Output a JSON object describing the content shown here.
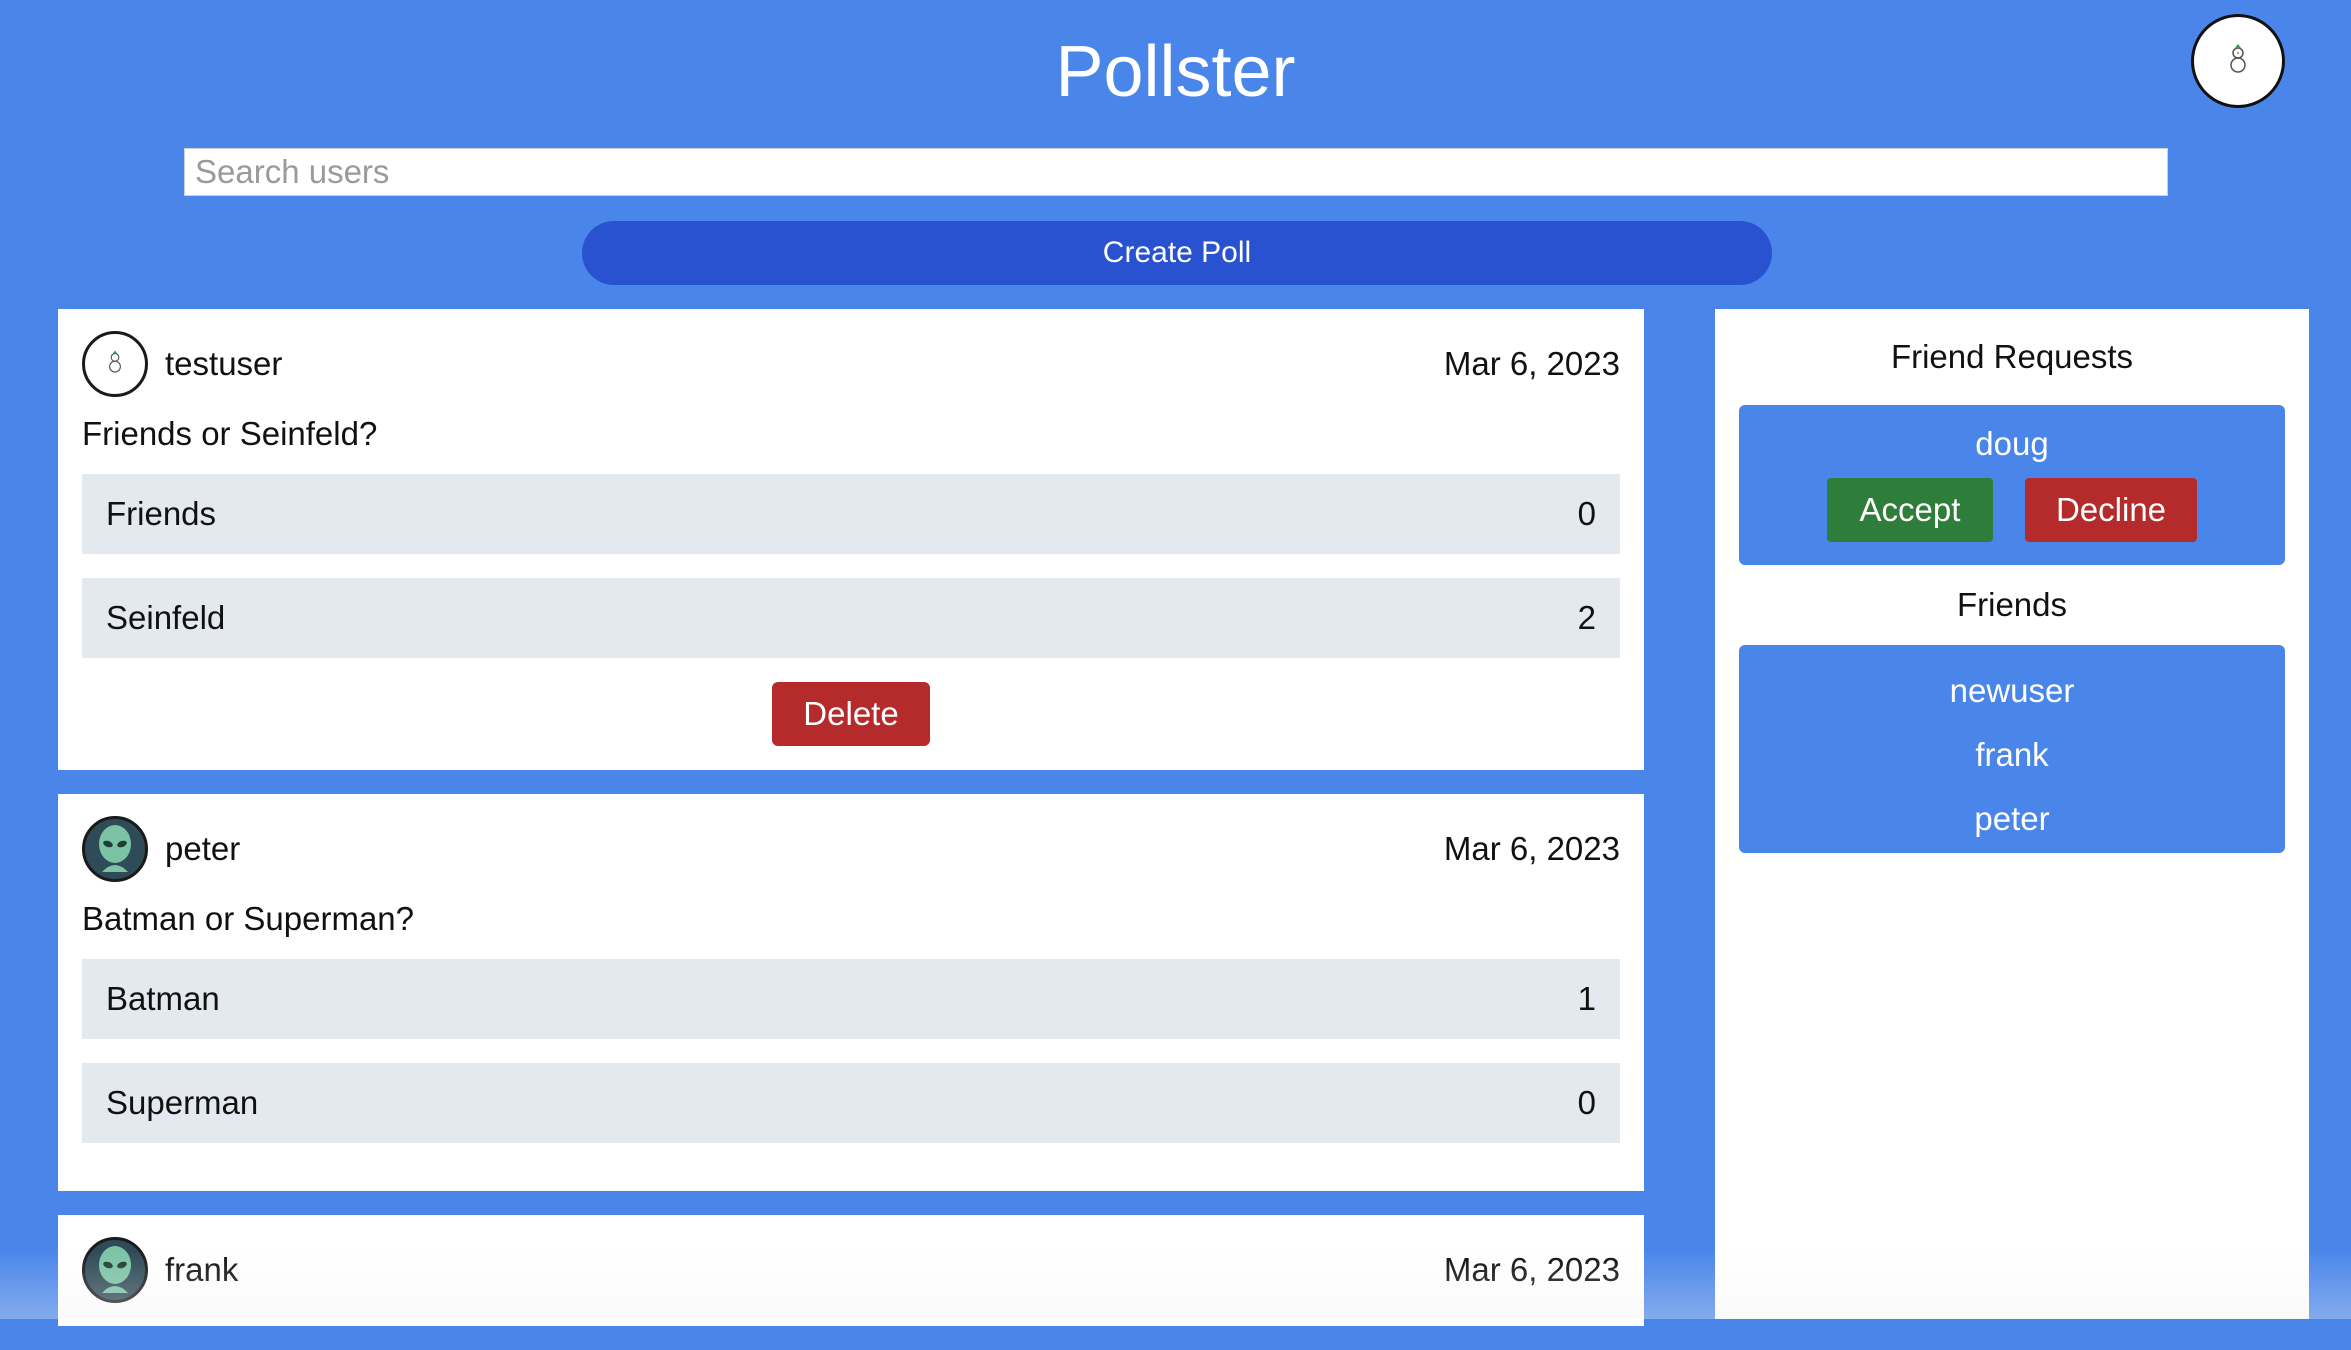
{
  "header": {
    "title": "Pollster",
    "profile_icon": "snowman-icon"
  },
  "search": {
    "placeholder": "Search users",
    "value": ""
  },
  "create_poll": {
    "label": "Create Poll"
  },
  "polls": [
    {
      "username": "testuser",
      "avatar_icon": "snowman-icon",
      "date": "Mar 6, 2023",
      "question": "Friends or Seinfeld?",
      "options": [
        {
          "label": "Friends",
          "votes": "0"
        },
        {
          "label": "Seinfeld",
          "votes": "2"
        }
      ],
      "delete_label": "Delete"
    },
    {
      "username": "peter",
      "avatar_icon": "alien-icon",
      "date": "Mar 6, 2023",
      "question": "Batman or Superman?",
      "options": [
        {
          "label": "Batman",
          "votes": "1"
        },
        {
          "label": "Superman",
          "votes": "0"
        }
      ]
    },
    {
      "username": "frank",
      "avatar_icon": "alien-icon",
      "date": "Mar 6, 2023"
    }
  ],
  "sidebar": {
    "requests_heading": "Friend Requests",
    "requests": [
      {
        "name": "doug",
        "accept_label": "Accept",
        "decline_label": "Decline"
      }
    ],
    "friends_heading": "Friends",
    "friends": [
      "newuser",
      "frank",
      "peter"
    ]
  },
  "colors": {
    "background": "#4a86ea",
    "primary_button": "#2852cf",
    "danger": "#b52a2a",
    "success": "#2e7d3a",
    "option_bg": "#e4e8ef"
  }
}
